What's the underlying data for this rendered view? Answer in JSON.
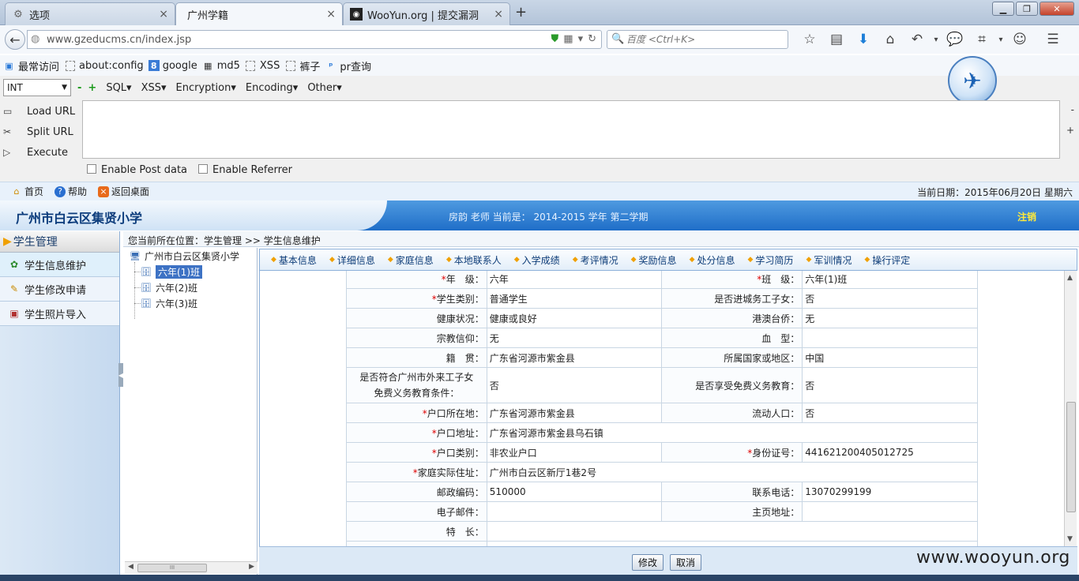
{
  "browser": {
    "tabs": [
      {
        "label": "选项",
        "icon": "gear-icon"
      },
      {
        "label": "广州学籍",
        "icon": "page-icon"
      },
      {
        "label": "WooYun.org | 提交漏洞",
        "icon": "wooyun-icon"
      }
    ],
    "url": "www.gzeducms.cn/index.jsp",
    "search_placeholder": "百度 <Ctrl+K>",
    "bookmarks": [
      "最常访问",
      "about:config",
      "google",
      "md5",
      "XSS",
      "裤子",
      "pr查询"
    ]
  },
  "hackbar": {
    "select_value": "INT",
    "menus": [
      "SQL",
      "XSS",
      "Encryption",
      "Encoding",
      "Other"
    ],
    "actions": [
      "Load URL",
      "Split URL",
      "Execute"
    ],
    "post_label": "Enable Post data",
    "referrer_label": "Enable Referrer",
    "minus": "-",
    "plus": "+"
  },
  "app": {
    "top_links": [
      "首页",
      "帮助",
      "返回桌面"
    ],
    "date_text": "当前日期：2015年06月20日 星期六",
    "school_name": "广州市白云区集贤小学",
    "teacher_info": "房韵 老师    当前是： 2014-2015 学年    第二学期",
    "logout": "注销",
    "sidebar_title": "学生管理",
    "sidebar_items": [
      "学生信息维护",
      "学生修改申请",
      "学生照片导入"
    ],
    "breadcrumb": "您当前所在位置：学生管理 >> 学生信息维护",
    "tree": {
      "root": "广州市白云区集贤小学",
      "children": [
        "六年(1)班",
        "六年(2)班",
        "六年(3)班"
      ]
    },
    "detail_tabs": [
      "基本信息",
      "详细信息",
      "家庭信息",
      "本地联系人",
      "入学成绩",
      "考评情况",
      "奖励信息",
      "处分信息",
      "学习简历",
      "军训情况",
      "操行评定"
    ],
    "form": {
      "grade_label": "年　级：",
      "grade": "六年",
      "class_label": "班　级：",
      "class": "六年(1)班",
      "type_label": "学生类别：",
      "type": "普通学生",
      "migrant_label": "是否进城务工子女：",
      "migrant": "否",
      "health_label": "健康状况：",
      "health": "健康或良好",
      "hmt_label": "港澳台侨：",
      "hmt": "无",
      "religion_label": "宗教信仰：",
      "religion": "无",
      "blood_label": "血　型：",
      "blood": "",
      "native_label": "籍　贯：",
      "native": "广东省河源市紫金县",
      "country_label": "所属国家或地区：",
      "country": "中国",
      "compulsory_label_1": "是否符合广州市外来工子女",
      "compulsory_label_2": "免费义务教育条件：",
      "compulsory": "否",
      "free_edu_label": "是否享受免费义务教育：",
      "free_edu": "否",
      "hukou_place_label": "户口所在地：",
      "hukou_place": "广东省河源市紫金县",
      "floating_label": "流动人口：",
      "floating": "否",
      "hukou_addr_label": "户口地址：",
      "hukou_addr": "广东省河源市紫金县乌石镇",
      "hukou_type_label": "户口类别：",
      "hukou_type": "非农业户口",
      "id_label": "身份证号：",
      "id_number": "441621200405012725",
      "home_addr_label": "家庭实际住址：",
      "home_addr": "广州市白云区新厅1巷2号",
      "postcode_label": "邮政编码：",
      "postcode": "510000",
      "phone_label": "联系电话：",
      "phone": "13070299199",
      "email_label": "电子邮件：",
      "email": "",
      "homepage_label": "主页地址：",
      "homepage": "",
      "specialty_label": "特　长：",
      "specialty": "",
      "required_mark": "*"
    },
    "buttons": {
      "edit": "修改",
      "cancel": "取消"
    }
  },
  "watermark": "www.wooyun.org"
}
